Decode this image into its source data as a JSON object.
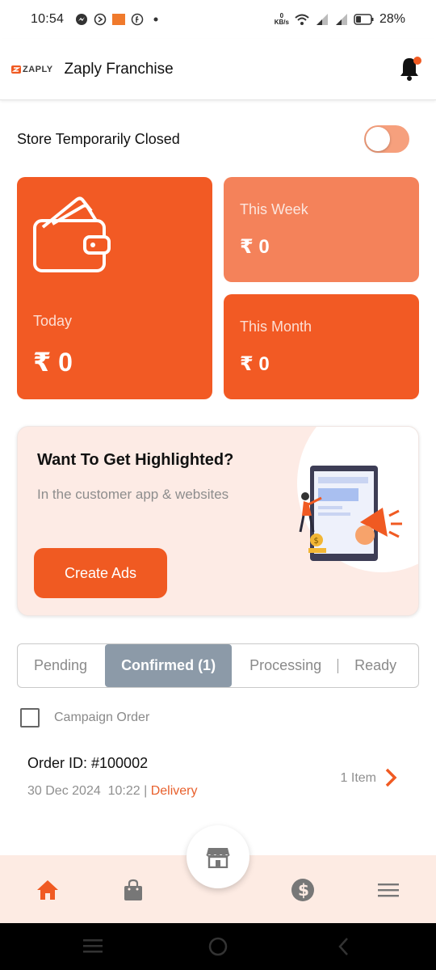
{
  "status_bar": {
    "time": "10:54",
    "net_speed_value": "0",
    "net_speed_unit": "KB/s",
    "battery": "28%"
  },
  "header": {
    "logo_text": "ZAPLY",
    "title": "Zaply Franchise"
  },
  "store": {
    "label": "Store Temporarily Closed",
    "toggle_on": false
  },
  "earnings": {
    "today": {
      "label": "Today",
      "value": "₹ 0"
    },
    "week": {
      "label": "This Week",
      "value": "₹ 0"
    },
    "month": {
      "label": "This Month",
      "value": "₹ 0"
    }
  },
  "banner": {
    "title": "Want To Get Highlighted?",
    "subtitle": "In the customer app & websites",
    "button_label": "Create Ads"
  },
  "tabs": [
    {
      "label": "Pending"
    },
    {
      "label": "Confirmed (1)",
      "active": true
    },
    {
      "label": "Processing"
    },
    {
      "label": "Ready"
    }
  ],
  "campaign": {
    "label": "Campaign Order",
    "checked": false
  },
  "orders": [
    {
      "id": "Order ID: #100002",
      "date": "30 Dec 2024",
      "time": "10:22",
      "type": "Delivery",
      "items": "1 Item"
    }
  ],
  "colors": {
    "accent": "#f05a22",
    "week_card": "#f4825a",
    "active_tab": "#8c9aa8",
    "nav_bg": "#fdebe3"
  },
  "bottom_nav": {
    "items": [
      "home-icon",
      "shopping-bag-icon",
      "store-icon",
      "dollar-icon",
      "menu-icon"
    ]
  }
}
